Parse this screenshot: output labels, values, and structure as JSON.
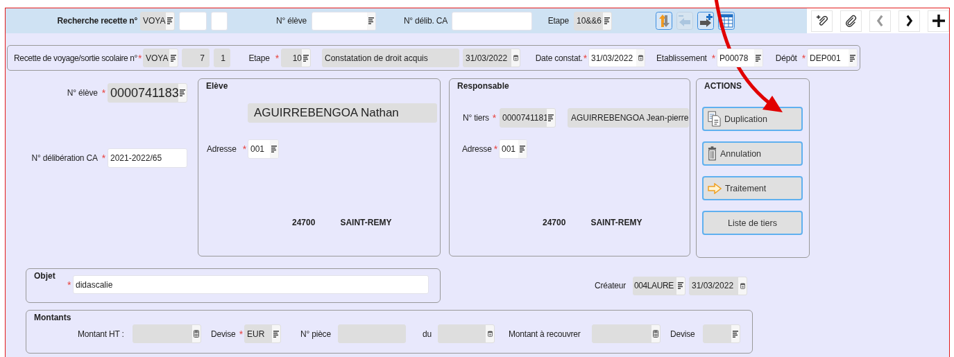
{
  "search_bar": {
    "items": [
      {
        "kind": "label",
        "text": "Recherche recette n°"
      },
      {
        "kind": "field",
        "value": "VOYA",
        "readonly": true,
        "picker": {
          "kind": "list"
        }
      },
      {
        "kind": "field",
        "readonly": false
      },
      {
        "kind": "field",
        "readonly": false
      },
      {
        "kind": "label",
        "text": "N° élève"
      },
      {
        "kind": "field",
        "readonly": false,
        "picker": {
          "kind": "list"
        }
      },
      {
        "kind": "label",
        "text": "N° délib. CA"
      },
      {
        "kind": "field",
        "readonly": false
      },
      {
        "kind": "label",
        "text": "Etape"
      },
      {
        "kind": "field",
        "value": "10&&6",
        "readonly": true,
        "picker": {
          "kind": "list"
        }
      }
    ],
    "tools": [
      {
        "kind": "swap",
        "disabled": false
      },
      {
        "kind": "back",
        "disabled": true
      },
      {
        "kind": "forward-add",
        "disabled": false
      },
      {
        "kind": "table",
        "disabled": false
      }
    ]
  },
  "toolbar": [
    {
      "kind": "attach-add",
      "disabled": false
    },
    {
      "kind": "attach",
      "disabled": false
    },
    {
      "kind": "previous",
      "disabled": true
    },
    {
      "kind": "next",
      "disabled": false
    },
    {
      "kind": "add",
      "disabled": false
    }
  ],
  "header": {
    "items": [
      {
        "kind": "label",
        "text": "Recette de voyage/sortie scolaire n°",
        "asterisk": "*"
      },
      {
        "kind": "field",
        "value": "VOYA",
        "readonly": true,
        "picker": {
          "kind": "list"
        }
      },
      {
        "kind": "field",
        "value": "7",
        "readonly": true
      },
      {
        "kind": "field",
        "value": "1",
        "readonly": true
      },
      {
        "kind": "label",
        "text": "Etape",
        "asterisk": "*"
      },
      {
        "kind": "field",
        "value": "10",
        "readonly": true,
        "picker": {
          "kind": "list"
        }
      },
      {
        "kind": "field",
        "value": "Constatation de droit acquis",
        "readonly": true
      },
      {
        "kind": "field",
        "value": "31/03/2022",
        "readonly": true,
        "picker": {
          "kind": "date"
        }
      },
      {
        "kind": "label",
        "text": "Date constat.",
        "asterisk": "*"
      },
      {
        "kind": "field",
        "value": "31/03/2022",
        "readonly": false,
        "picker": {
          "kind": "date"
        }
      },
      {
        "kind": "label",
        "text": "Etablissement",
        "asterisk": "*"
      },
      {
        "kind": "field",
        "value": "P00078",
        "readonly": false,
        "picker": {
          "kind": "list"
        }
      },
      {
        "kind": "label",
        "text": "Dépôt",
        "asterisk": "*"
      },
      {
        "kind": "field",
        "value": "DEP001",
        "readonly": false,
        "picker": {
          "kind": "list"
        }
      }
    ]
  },
  "student_fields": {
    "rows": [
      [
        {
          "kind": "label",
          "text": "N° élève",
          "asterisk": "*"
        },
        {
          "kind": "field",
          "value": "0000741183",
          "readonly": true,
          "picker": {
            "kind": "list"
          }
        }
      ],
      [
        {
          "kind": "label",
          "text": "N° délibération CA",
          "asterisk": "*"
        },
        {
          "kind": "field",
          "value": "2021-2022/65",
          "readonly": false
        }
      ]
    ]
  },
  "student": {
    "title": "Elève",
    "items": [
      {
        "kind": "field",
        "value": "AGUIRREBENGOA Nathan",
        "readonly": true
      }
    ],
    "address": [
      {
        "kind": "label",
        "text": "Adresse",
        "asterisk": "*"
      },
      {
        "kind": "field",
        "value": "001",
        "readonly": false,
        "picker": {
          "kind": "list"
        }
      }
    ],
    "postcode": "24700",
    "city": "SAINT-REMY"
  },
  "guardian": {
    "title": "Responsable",
    "items": [
      {
        "kind": "label",
        "text": "N° tiers",
        "asterisk": "*"
      },
      {
        "kind": "field",
        "value": "0000741181",
        "readonly": true,
        "picker": {
          "kind": "list"
        }
      },
      {
        "kind": "field",
        "value": "AGUIRREBENGOA Jean-pierre",
        "readonly": true
      }
    ],
    "address": [
      {
        "kind": "label",
        "text": "Adresse",
        "asterisk": "*"
      },
      {
        "kind": "field",
        "value": "001",
        "readonly": false,
        "picker": {
          "kind": "list"
        }
      }
    ],
    "postcode": "24700",
    "city": "SAINT-REMY"
  },
  "actions": {
    "title": "ACTIONS",
    "buttons": [
      {
        "label": "Duplication",
        "kind": "copy"
      },
      {
        "label": "Annulation",
        "kind": "trash"
      },
      {
        "label": "Traitement",
        "kind": "arrow"
      },
      {
        "label": "Liste de tiers",
        "kind": "text"
      }
    ]
  },
  "object": {
    "title": "Objet",
    "items": [
      {
        "kind": "label",
        "asterisk": "*"
      },
      {
        "kind": "field",
        "value": "didascalie",
        "readonly": false
      }
    ]
  },
  "creator": {
    "items": [
      {
        "kind": "label",
        "text": "Créateur"
      },
      {
        "kind": "field",
        "value": "004LAURE",
        "readonly": true,
        "picker": {
          "kind": "list"
        }
      },
      {
        "kind": "field",
        "value": "31/03/2022",
        "readonly": true,
        "picker": {
          "kind": "date"
        }
      }
    ]
  },
  "amounts": {
    "title": "Montants",
    "items": [
      {
        "kind": "label",
        "text": "Montant HT :"
      },
      {
        "kind": "field",
        "readonly": true,
        "picker": {
          "kind": "calc"
        }
      },
      {
        "kind": "label",
        "text": "Devise",
        "asterisk": "*"
      },
      {
        "kind": "field",
        "value": "EUR",
        "readonly": true,
        "picker": {
          "kind": "list"
        }
      },
      {
        "kind": "label",
        "text": "N° pièce"
      },
      {
        "kind": "field",
        "readonly": true
      },
      {
        "kind": "label",
        "text": "du"
      },
      {
        "kind": "field",
        "readonly": true,
        "picker": {
          "kind": "date"
        }
      },
      {
        "kind": "label",
        "text": "Montant à recouvrer"
      },
      {
        "kind": "field",
        "readonly": true,
        "picker": {
          "kind": "calc"
        }
      },
      {
        "kind": "label",
        "text": "Devise"
      },
      {
        "kind": "field",
        "readonly": true,
        "picker": {
          "kind": "list"
        }
      }
    ]
  },
  "annotation": {
    "kind": "arrow"
  }
}
